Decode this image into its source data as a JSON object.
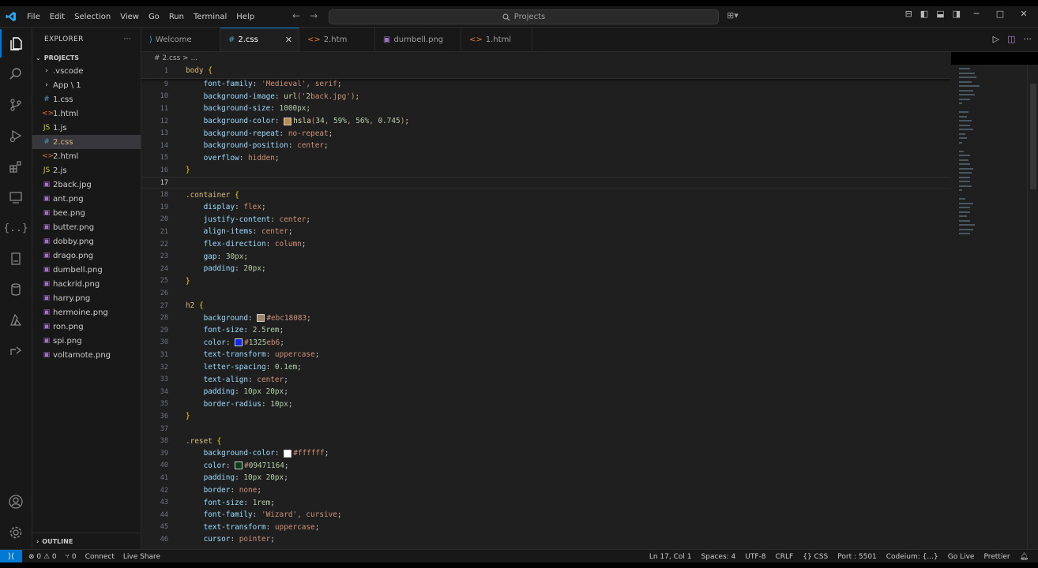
{
  "titlebar": {
    "menu": [
      "File",
      "Edit",
      "Selection",
      "View",
      "Go",
      "Run",
      "Terminal",
      "Help"
    ],
    "search_text": "Projects",
    "search_icon": "search-icon"
  },
  "activity_icons": [
    "files-icon",
    "search-icon",
    "source-control-icon",
    "run-debug-icon",
    "extensions-icon",
    "remote-explorer-icon",
    "json-braces-icon",
    "book-icon",
    "database-icon",
    "azure-icon",
    "live-share-icon",
    "account-icon",
    "settings-gear-icon"
  ],
  "sidebar": {
    "title": "EXPLORER",
    "more": "···",
    "project": "PROJECTS",
    "items": [
      {
        "label": ".vscode",
        "icon": "›",
        "kind": "folder",
        "indent": 1
      },
      {
        "label": "App \\ 1",
        "icon": "›",
        "kind": "folder",
        "indent": 1
      },
      {
        "label": "1.css",
        "icon": "#",
        "kind": "css",
        "indent": 2
      },
      {
        "label": "1.html",
        "icon": "<>",
        "kind": "html",
        "indent": 2
      },
      {
        "label": "1.js",
        "icon": "JS",
        "kind": "js",
        "indent": 2
      },
      {
        "label": "2.css",
        "icon": "#",
        "kind": "css",
        "indent": 2,
        "selected": true
      },
      {
        "label": "2.html",
        "icon": "<>",
        "kind": "html",
        "indent": 2
      },
      {
        "label": "2.js",
        "icon": "JS",
        "kind": "js",
        "indent": 2
      },
      {
        "label": "2back.jpg",
        "icon": "▣",
        "kind": "img",
        "indent": 2
      },
      {
        "label": "ant.png",
        "icon": "▣",
        "kind": "img",
        "indent": 2
      },
      {
        "label": "bee.png",
        "icon": "▣",
        "kind": "img",
        "indent": 2
      },
      {
        "label": "butter.png",
        "icon": "▣",
        "kind": "img",
        "indent": 2
      },
      {
        "label": "dobby.png",
        "icon": "▣",
        "kind": "img",
        "indent": 2
      },
      {
        "label": "drago.png",
        "icon": "▣",
        "kind": "img",
        "indent": 2
      },
      {
        "label": "dumbell.png",
        "icon": "▣",
        "kind": "img",
        "indent": 2
      },
      {
        "label": "hackrid.png",
        "icon": "▣",
        "kind": "img",
        "indent": 2
      },
      {
        "label": "harry.png",
        "icon": "▣",
        "kind": "img",
        "indent": 2
      },
      {
        "label": "hermoine.png",
        "icon": "▣",
        "kind": "img",
        "indent": 2
      },
      {
        "label": "ron.png",
        "icon": "▣",
        "kind": "img",
        "indent": 2
      },
      {
        "label": "spi.png",
        "icon": "▣",
        "kind": "img",
        "indent": 2
      },
      {
        "label": "voltamote.png",
        "icon": "▣",
        "kind": "img",
        "indent": 2
      }
    ],
    "outline": "OUTLINE"
  },
  "tabs": [
    {
      "label": "Welcome",
      "icon": "vscode-icon",
      "active": false
    },
    {
      "label": "2.css",
      "icon": "#",
      "active": true
    },
    {
      "label": "2.htm",
      "icon": "<>",
      "active": false
    },
    {
      "label": "dumbell.png",
      "icon": "▣",
      "active": false
    },
    {
      "label": "1.html",
      "icon": "<>",
      "active": false
    }
  ],
  "breadcrumb": "# 2.css > ...",
  "editor": {
    "current_line": 17,
    "lines": [
      {
        "n": 1,
        "t": "body {",
        "sticky": true
      },
      {
        "n": 9,
        "t": "    font-family: 'Medieval', serif;"
      },
      {
        "n": 10,
        "t": "    background-image: url('2back.jpg');"
      },
      {
        "n": 11,
        "t": "    background-size: 1000px;"
      },
      {
        "n": 12,
        "t": "    background-color: hsla(34, 59%, 56%, 0.745);",
        "swatch": "#b98b4f"
      },
      {
        "n": 13,
        "t": "    background-repeat: no-repeat;"
      },
      {
        "n": 14,
        "t": "    background-position: center;"
      },
      {
        "n": 15,
        "t": "    overflow: hidden;"
      },
      {
        "n": 16,
        "t": "}"
      },
      {
        "n": 17,
        "t": ""
      },
      {
        "n": 18,
        "t": ".container {"
      },
      {
        "n": 19,
        "t": "    display: flex;"
      },
      {
        "n": 20,
        "t": "    justify-content: center;"
      },
      {
        "n": 21,
        "t": "    align-items: center;"
      },
      {
        "n": 22,
        "t": "    flex-direction: column;"
      },
      {
        "n": 23,
        "t": "    gap: 30px;"
      },
      {
        "n": 24,
        "t": "    padding: 20px;"
      },
      {
        "n": 25,
        "t": "}"
      },
      {
        "n": 26,
        "t": ""
      },
      {
        "n": 27,
        "t": "h2 {"
      },
      {
        "n": 28,
        "t": "    background: #ebc18083;",
        "swatch": "#a0826a"
      },
      {
        "n": 29,
        "t": "    font-size: 2.5rem;"
      },
      {
        "n": 30,
        "t": "    color: #1325eb6;",
        "swatch": "#1325eb"
      },
      {
        "n": 31,
        "t": "    text-transform: uppercase;"
      },
      {
        "n": 32,
        "t": "    letter-spacing: 0.1em;"
      },
      {
        "n": 33,
        "t": "    text-align: center;"
      },
      {
        "n": 34,
        "t": "    padding: 10px 20px;"
      },
      {
        "n": 35,
        "t": "    border-radius: 10px;"
      },
      {
        "n": 36,
        "t": "}"
      },
      {
        "n": 37,
        "t": ""
      },
      {
        "n": 38,
        "t": ".reset {"
      },
      {
        "n": 39,
        "t": "    background-color: #ffffff;",
        "swatch": "#ffffff"
      },
      {
        "n": 40,
        "t": "    color: #09471164;",
        "swatch": "#0d3d17"
      },
      {
        "n": 41,
        "t": "    padding: 10px 20px;"
      },
      {
        "n": 42,
        "t": "    border: none;"
      },
      {
        "n": 43,
        "t": "    font-size: 1rem;"
      },
      {
        "n": 44,
        "t": "    font-family: 'Wizard', cursive;"
      },
      {
        "n": 45,
        "t": "    text-transform: uppercase;"
      },
      {
        "n": 46,
        "t": "    cursor: pointer;"
      }
    ]
  },
  "statusbar": {
    "left": [
      "⊗ 0 ⚠ 0",
      "⑂ 0",
      "Connect",
      "Live Share"
    ],
    "right": [
      "Ln 17, Col 1",
      "Spaces: 4",
      "UTF-8",
      "CRLF",
      "{} CSS",
      "Port : 5501",
      "Codeium: {...}",
      "Go Live",
      "Prettier"
    ]
  },
  "colors": {
    "accent": "#0078d4",
    "editor_bg": "#1f1f1f",
    "sidebar_bg": "#181818",
    "selector": "#d7ba7d",
    "property": "#9cdcfe",
    "value": "#ce9178"
  }
}
